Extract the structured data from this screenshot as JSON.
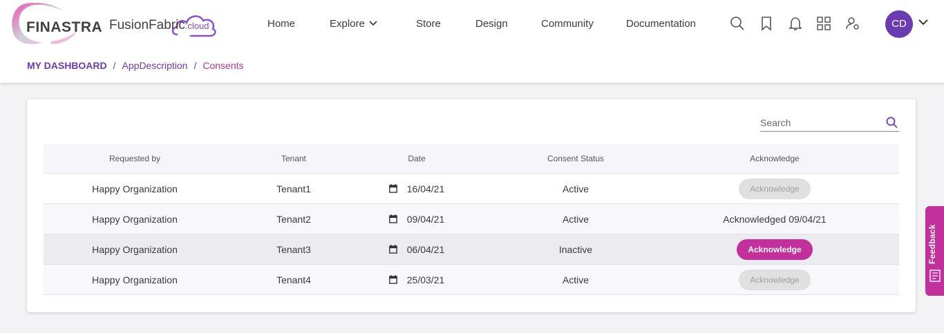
{
  "brand": {
    "name": "FINASTRA",
    "product": "FusionFabric",
    "product_suffix": ".cloud",
    "accent": "#6b3bb3",
    "magenta": "#c1309b"
  },
  "nav": {
    "items": [
      {
        "label": "Home"
      },
      {
        "label": "Explore"
      },
      {
        "label": "Store"
      },
      {
        "label": "Design"
      },
      {
        "label": "Community"
      },
      {
        "label": "Documentation"
      }
    ]
  },
  "header_icons": [
    "search-icon",
    "bookmark-icon",
    "bell-icon",
    "grid-icon",
    "user-settings-icon"
  ],
  "user": {
    "initials": "CD"
  },
  "breadcrumb": {
    "home": "MY DASHBOARD",
    "sep": "/",
    "middle": "AppDescription",
    "current": "Consents"
  },
  "search": {
    "placeholder": "Search"
  },
  "table": {
    "headers": {
      "requested_by": "Requested by",
      "tenant": "Tenant",
      "date": "Date",
      "status": "Consent Status",
      "acknowledge": "Acknowledge"
    },
    "rows": [
      {
        "requested_by": "Happy Organization",
        "tenant": "Tenant1",
        "date": "16/04/21",
        "status": "Active",
        "ack_label": "Acknowledge",
        "ack_state": "disabled"
      },
      {
        "requested_by": "Happy Organization",
        "tenant": "Tenant2",
        "date": "09/04/21",
        "status": "Active",
        "ack_label": "Acknowledged 09/04/21",
        "ack_state": "done"
      },
      {
        "requested_by": "Happy Organization",
        "tenant": "Tenant3",
        "date": "06/04/21",
        "status": "Inactive",
        "ack_label": "Acknowledge",
        "ack_state": "active"
      },
      {
        "requested_by": "Happy Organization",
        "tenant": "Tenant4",
        "date": "25/03/21",
        "status": "Active",
        "ack_label": "Acknowledge",
        "ack_state": "disabled"
      }
    ]
  },
  "feedback": {
    "label": "Feedback"
  }
}
